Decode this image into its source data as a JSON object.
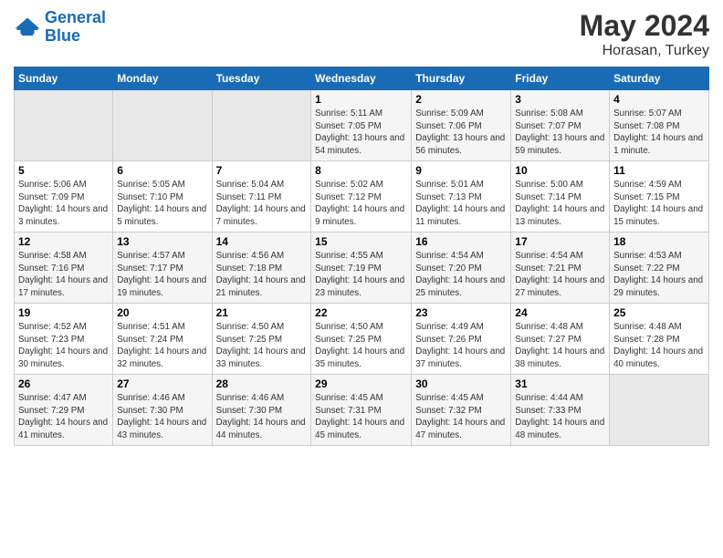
{
  "header": {
    "logo_line1": "General",
    "logo_line2": "Blue",
    "title": "May 2024",
    "location": "Horasan, Turkey"
  },
  "days_of_week": [
    "Sunday",
    "Monday",
    "Tuesday",
    "Wednesday",
    "Thursday",
    "Friday",
    "Saturday"
  ],
  "weeks": [
    {
      "days": [
        {
          "number": "",
          "empty": true
        },
        {
          "number": "",
          "empty": true
        },
        {
          "number": "",
          "empty": true
        },
        {
          "number": "1",
          "sunrise": "5:11 AM",
          "sunset": "7:05 PM",
          "daylight": "13 hours and 54 minutes."
        },
        {
          "number": "2",
          "sunrise": "5:09 AM",
          "sunset": "7:06 PM",
          "daylight": "13 hours and 56 minutes."
        },
        {
          "number": "3",
          "sunrise": "5:08 AM",
          "sunset": "7:07 PM",
          "daylight": "13 hours and 59 minutes."
        },
        {
          "number": "4",
          "sunrise": "5:07 AM",
          "sunset": "7:08 PM",
          "daylight": "14 hours and 1 minute."
        }
      ]
    },
    {
      "days": [
        {
          "number": "5",
          "sunrise": "5:06 AM",
          "sunset": "7:09 PM",
          "daylight": "14 hours and 3 minutes."
        },
        {
          "number": "6",
          "sunrise": "5:05 AM",
          "sunset": "7:10 PM",
          "daylight": "14 hours and 5 minutes."
        },
        {
          "number": "7",
          "sunrise": "5:04 AM",
          "sunset": "7:11 PM",
          "daylight": "14 hours and 7 minutes."
        },
        {
          "number": "8",
          "sunrise": "5:02 AM",
          "sunset": "7:12 PM",
          "daylight": "14 hours and 9 minutes."
        },
        {
          "number": "9",
          "sunrise": "5:01 AM",
          "sunset": "7:13 PM",
          "daylight": "14 hours and 11 minutes."
        },
        {
          "number": "10",
          "sunrise": "5:00 AM",
          "sunset": "7:14 PM",
          "daylight": "14 hours and 13 minutes."
        },
        {
          "number": "11",
          "sunrise": "4:59 AM",
          "sunset": "7:15 PM",
          "daylight": "14 hours and 15 minutes."
        }
      ]
    },
    {
      "days": [
        {
          "number": "12",
          "sunrise": "4:58 AM",
          "sunset": "7:16 PM",
          "daylight": "14 hours and 17 minutes."
        },
        {
          "number": "13",
          "sunrise": "4:57 AM",
          "sunset": "7:17 PM",
          "daylight": "14 hours and 19 minutes."
        },
        {
          "number": "14",
          "sunrise": "4:56 AM",
          "sunset": "7:18 PM",
          "daylight": "14 hours and 21 minutes."
        },
        {
          "number": "15",
          "sunrise": "4:55 AM",
          "sunset": "7:19 PM",
          "daylight": "14 hours and 23 minutes."
        },
        {
          "number": "16",
          "sunrise": "4:54 AM",
          "sunset": "7:20 PM",
          "daylight": "14 hours and 25 minutes."
        },
        {
          "number": "17",
          "sunrise": "4:54 AM",
          "sunset": "7:21 PM",
          "daylight": "14 hours and 27 minutes."
        },
        {
          "number": "18",
          "sunrise": "4:53 AM",
          "sunset": "7:22 PM",
          "daylight": "14 hours and 29 minutes."
        }
      ]
    },
    {
      "days": [
        {
          "number": "19",
          "sunrise": "4:52 AM",
          "sunset": "7:23 PM",
          "daylight": "14 hours and 30 minutes."
        },
        {
          "number": "20",
          "sunrise": "4:51 AM",
          "sunset": "7:24 PM",
          "daylight": "14 hours and 32 minutes."
        },
        {
          "number": "21",
          "sunrise": "4:50 AM",
          "sunset": "7:25 PM",
          "daylight": "14 hours and 33 minutes."
        },
        {
          "number": "22",
          "sunrise": "4:50 AM",
          "sunset": "7:25 PM",
          "daylight": "14 hours and 35 minutes."
        },
        {
          "number": "23",
          "sunrise": "4:49 AM",
          "sunset": "7:26 PM",
          "daylight": "14 hours and 37 minutes."
        },
        {
          "number": "24",
          "sunrise": "4:48 AM",
          "sunset": "7:27 PM",
          "daylight": "14 hours and 38 minutes."
        },
        {
          "number": "25",
          "sunrise": "4:48 AM",
          "sunset": "7:28 PM",
          "daylight": "14 hours and 40 minutes."
        }
      ]
    },
    {
      "days": [
        {
          "number": "26",
          "sunrise": "4:47 AM",
          "sunset": "7:29 PM",
          "daylight": "14 hours and 41 minutes."
        },
        {
          "number": "27",
          "sunrise": "4:46 AM",
          "sunset": "7:30 PM",
          "daylight": "14 hours and 43 minutes."
        },
        {
          "number": "28",
          "sunrise": "4:46 AM",
          "sunset": "7:30 PM",
          "daylight": "14 hours and 44 minutes."
        },
        {
          "number": "29",
          "sunrise": "4:45 AM",
          "sunset": "7:31 PM",
          "daylight": "14 hours and 45 minutes."
        },
        {
          "number": "30",
          "sunrise": "4:45 AM",
          "sunset": "7:32 PM",
          "daylight": "14 hours and 47 minutes."
        },
        {
          "number": "31",
          "sunrise": "4:44 AM",
          "sunset": "7:33 PM",
          "daylight": "14 hours and 48 minutes."
        },
        {
          "number": "",
          "empty": true
        }
      ]
    }
  ]
}
